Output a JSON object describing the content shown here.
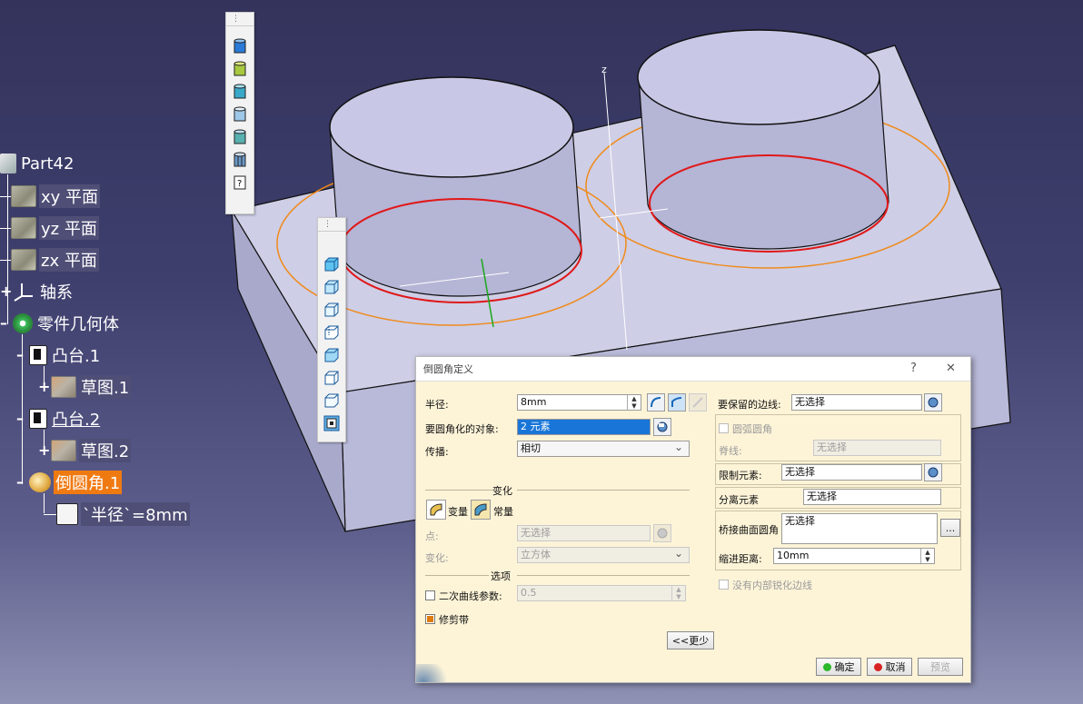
{
  "tree": {
    "root": "Part42",
    "xy_plane": "xy 平面",
    "yz_plane": "yz 平面",
    "zx_plane": "zx 平面",
    "axis": "轴系",
    "body": "零件几何体",
    "pad1": "凸台.1",
    "sketch1": "草图.1",
    "pad2": "凸台.2",
    "sketch2": "草图.2",
    "fillet": "倒圆角.1",
    "param": "`半径`=8mm"
  },
  "viewport": {
    "axis_z": "z"
  },
  "dialog": {
    "title": "倒圆角定义",
    "help": "?",
    "close": "✕",
    "radius_label": "半径:",
    "radius_value": "8mm",
    "objects_label": "要圆角化的对象:",
    "objects_value": "2 元素",
    "propagation_label": "传播:",
    "propagation_value": "相切",
    "variation_title": "变化",
    "variable_label": "变量",
    "constant_label": "常量",
    "point_label": "点:",
    "point_value": "无选择",
    "variation_label": "变化:",
    "variation_value": "立方体",
    "options_title": "选项",
    "conic_label": "二次曲线参数:",
    "conic_value": "0.5",
    "trim_label": "修剪带",
    "less_button": "<<更少",
    "edges_keep_label": "要保留的边线:",
    "edges_keep_value": "无选择",
    "circle_fillet_label": "圆弧圆角",
    "spine_label": "脊线:",
    "spine_value": "无选择",
    "limit_label": "限制元素:",
    "limit_value": "无选择",
    "separate_label": "分离元素",
    "separate_value": "无选择",
    "blend_label": "桥接曲面圆角",
    "blend_value": "无选择",
    "blend_more": "...",
    "setback_label": "缩进距离:",
    "setback_value": "10mm",
    "no_internal_label": "没有内部锐化边线",
    "ok": "确定",
    "cancel": "取消",
    "preview": "预览"
  },
  "colors": {
    "background_top": "#33335c",
    "background_bottom": "#8f92b4",
    "part_face": "#cfcfe8",
    "fillet_edge": "#e01818",
    "construction": "#f08a1a",
    "selection": "#f07a12",
    "dialog_bg": "#fdf4d8"
  }
}
